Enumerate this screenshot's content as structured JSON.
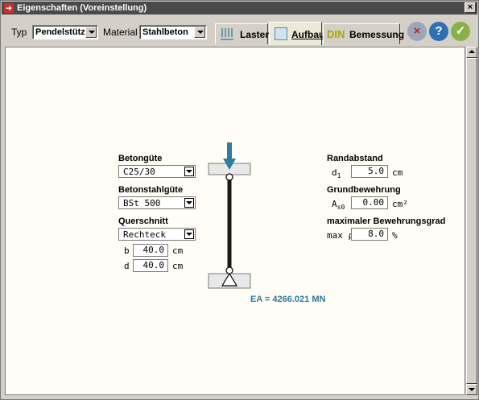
{
  "window": {
    "title": "Eigenschaften (Voreinstellung)",
    "close_glyph": "×"
  },
  "toolbar": {
    "typ_label": "Typ",
    "typ_value": "Pendelstütze",
    "material_label": "Material",
    "material_value": "Stahlbeton",
    "tabs": [
      {
        "label": "Lasten"
      },
      {
        "label": "Aufbau",
        "active": true
      },
      {
        "label": "Bemessung",
        "icon_text": "DIN"
      }
    ],
    "buttons": {
      "cancel": "×",
      "help": "?",
      "ok": "✓"
    }
  },
  "left": {
    "betongute_label": "Betongüte",
    "betongute_value": "C25/30",
    "betonstahlgute_label": "Betonstahlgüte",
    "betonstahlgute_value": "BSt 500",
    "querschnitt_label": "Querschnitt",
    "querschnitt_value": "Rechteck",
    "b_label": "b",
    "b_value": "40.0",
    "b_unit": "cm",
    "d_label": "d",
    "d_value": "40.0",
    "d_unit": "cm"
  },
  "diagram": {
    "ea_text": "EA = 4266.021 MN"
  },
  "right": {
    "randabstand_label": "Randabstand",
    "d1_symbol": "d",
    "d1_sub": "1",
    "d1_value": "5.0",
    "d1_unit": "cm",
    "grundbewehrung_label": "Grundbewehrung",
    "as0_symbol": "A",
    "as0_sub": "s0",
    "as0_value": "0.00",
    "as0_unit": "cm²",
    "maxgrad_label": "maximaler Bewehrungsgrad",
    "maxrho_label": "max ρ",
    "maxrho_value": "8.0",
    "maxrho_unit": "%"
  },
  "colors": {
    "arrow": "#2f7d98",
    "ea_text": "#2a7a9e"
  }
}
